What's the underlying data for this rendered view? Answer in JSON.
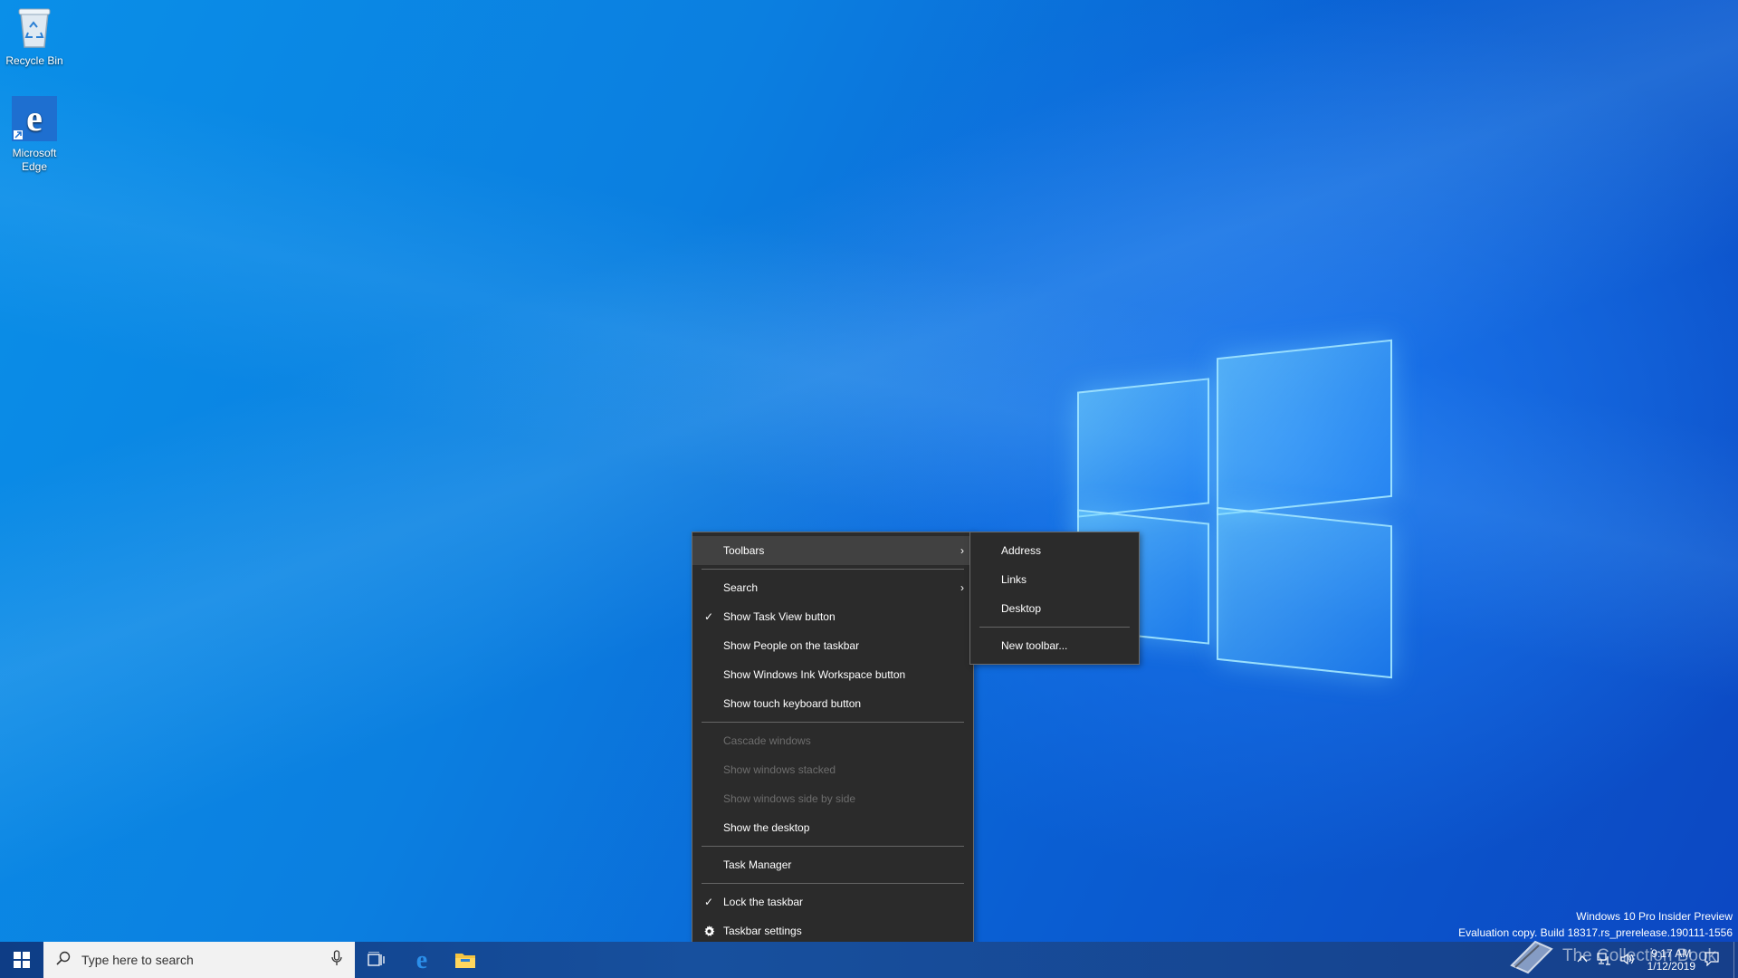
{
  "desktop": {
    "icons": [
      {
        "label_line1": "Recycle Bin",
        "label_line2": ""
      },
      {
        "label_line1": "Microsoft",
        "label_line2": "Edge"
      }
    ]
  },
  "context_menu": {
    "items": [
      {
        "label": "Toolbars",
        "submenu": true,
        "checked": false,
        "enabled": true,
        "highlighted": true
      },
      {
        "label": "Search",
        "submenu": true,
        "checked": false,
        "enabled": true
      },
      {
        "label": "Show Task View button",
        "checked": true,
        "enabled": true
      },
      {
        "label": "Show People on the taskbar",
        "checked": false,
        "enabled": true
      },
      {
        "label": "Show Windows Ink Workspace button",
        "checked": false,
        "enabled": true
      },
      {
        "label": "Show touch keyboard button",
        "checked": false,
        "enabled": true
      },
      {
        "label": "Cascade windows",
        "checked": false,
        "enabled": false
      },
      {
        "label": "Show windows stacked",
        "checked": false,
        "enabled": false
      },
      {
        "label": "Show windows side by side",
        "checked": false,
        "enabled": false
      },
      {
        "label": "Show the desktop",
        "checked": false,
        "enabled": true
      },
      {
        "label": "Task Manager",
        "checked": false,
        "enabled": true
      },
      {
        "label": "Lock the taskbar",
        "checked": true,
        "enabled": true
      },
      {
        "label": "Taskbar settings",
        "icon": "gear-icon",
        "enabled": true
      }
    ],
    "check_glyph": "✓",
    "arrow_glyph": "›"
  },
  "toolbars_submenu": {
    "items": [
      {
        "label": "Address"
      },
      {
        "label": "Links"
      },
      {
        "label": "Desktop"
      },
      {
        "label": "New toolbar..."
      }
    ]
  },
  "taskbar": {
    "search_placeholder": "Type here to search",
    "pinned": [
      "task-view-icon",
      "edge-icon",
      "file-explorer-icon"
    ],
    "clock_time": "9:17 AM",
    "clock_date": "1/12/2019"
  },
  "watermark": {
    "line1": "Windows 10 Pro Insider Preview",
    "line2": "Evaluation copy. Build 18317.rs_prerelease.190111-1556"
  },
  "overlay_text": "The Collection Book",
  "colors": {
    "menu_bg": "#2b2b2b",
    "menu_hover": "#414141",
    "disabled_text": "#6d6d6d",
    "taskbar": "#17509e"
  }
}
